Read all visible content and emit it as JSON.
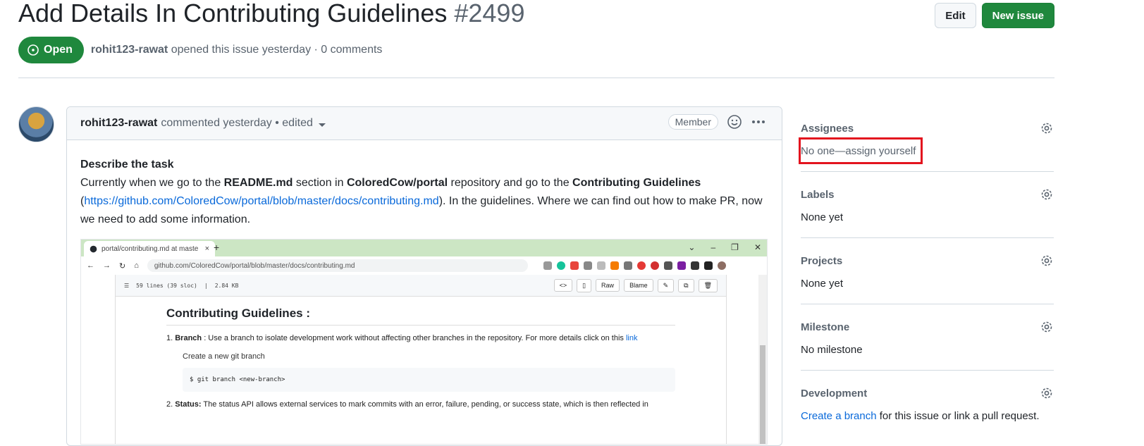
{
  "issue": {
    "title": "Add Details In Contributing Guidelines",
    "number": "#2499",
    "state": "Open",
    "author": "rohit123-rawat",
    "meta": "opened this issue yesterday · 0 comments"
  },
  "header_actions": {
    "edit": "Edit",
    "new_issue": "New issue"
  },
  "comment": {
    "author": "rohit123-rawat",
    "meta": "commented yesterday • edited",
    "badge": "Member",
    "heading": "Describe the task",
    "p_part1": "Currently when we go to the ",
    "p_bold1": "README.md",
    "p_part2": " section in ",
    "p_bold2": "ColoredCow/portal",
    "p_part3": " repository and go to the ",
    "p_bold3": "Contributing Guidelines",
    "p_open": "(",
    "p_link": "https://github.com/ColoredCow/portal/blob/master/docs/contributing.md",
    "p_part4": "). In the guidelines. Where we can find out how to make PR, now we need to add some information."
  },
  "screenshot": {
    "tab_title": "portal/contributing.md at maste",
    "url": "github.com/ColoredCow/portal/blob/master/docs/contributing.md",
    "file_lines": "59 lines (39 sloc)",
    "file_size": "2.84 KB",
    "raw": "Raw",
    "blame": "Blame",
    "md_title": "Contributing Guidelines :",
    "item1_bold": "Branch",
    "item1_text": " : Use a branch to isolate development work without affecting other branches in the repository. For more details click on this ",
    "item1_link": "link",
    "item1_sub": "Create a new git branch",
    "item1_code": "$ git branch <new-branch>",
    "item2_bold": "Status:",
    "item2_text": " The status API allows external services to mark commits with an error, failure, pending, or success state, which is then reflected in"
  },
  "sidebar": [
    {
      "title": "Assignees",
      "value": "No one—assign yourself"
    },
    {
      "title": "Labels",
      "value": "None yet"
    },
    {
      "title": "Projects",
      "value": "None yet"
    },
    {
      "title": "Milestone",
      "value": "No milestone"
    },
    {
      "title": "Development",
      "value_link": "Create a branch",
      "value_rest": " for this issue or link a pull request."
    }
  ],
  "colors": {
    "open_green": "#1f883d",
    "link_blue": "#0969da",
    "highlight_red": "#e3141e"
  }
}
